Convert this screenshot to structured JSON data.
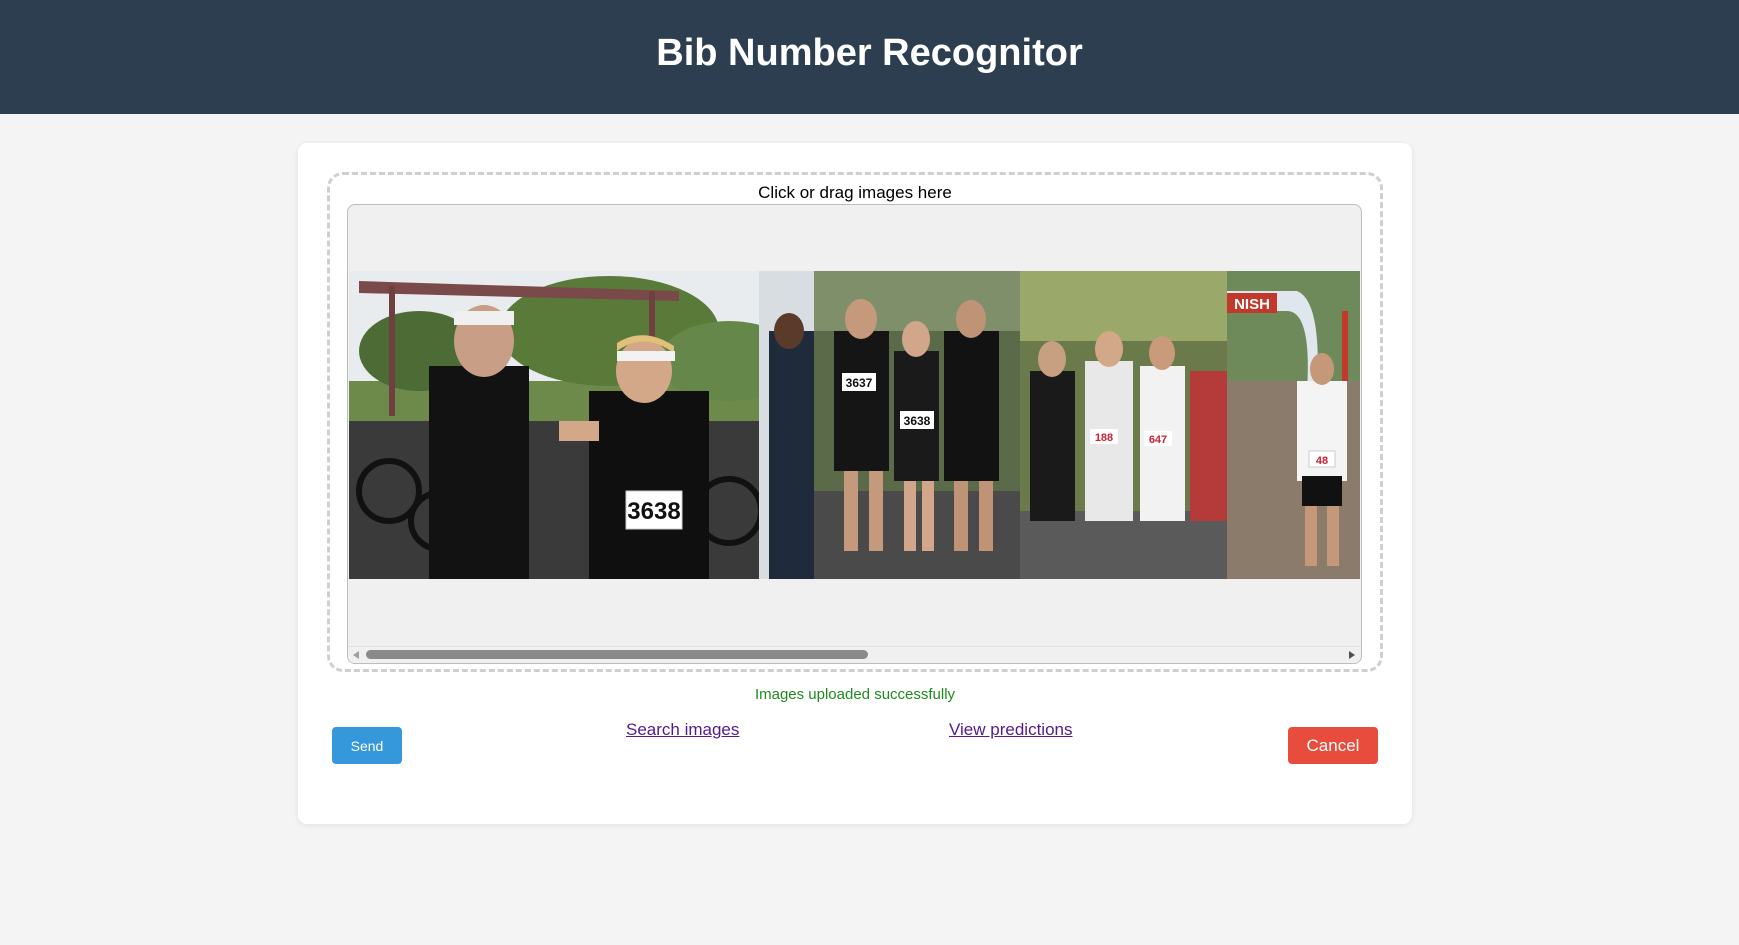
{
  "header": {
    "title": "Bib Number Recognitor"
  },
  "dropzone": {
    "label": "Click or drag images here"
  },
  "gallery": {
    "images": [
      {
        "name": "transition-area-photo",
        "bib": "3638"
      },
      {
        "name": "runners-group-photo",
        "bibs": [
          "3637",
          "3638"
        ]
      },
      {
        "name": "start-line-crowd-photo",
        "bibs": [
          "188",
          "647"
        ]
      },
      {
        "name": "finish-arch-photo",
        "banner": "NISH",
        "bib": "48"
      }
    ]
  },
  "status": {
    "message": "Images uploaded successfully",
    "color": "#1e8a1e"
  },
  "actions": {
    "send_label": "Send",
    "search_label": "Search images",
    "predictions_label": "View predictions",
    "cancel_label": "Cancel"
  },
  "colors": {
    "header_bg": "#2c3e50",
    "send_bg": "#3498db",
    "cancel_bg": "#e74c3c",
    "link": "#551a8b"
  }
}
